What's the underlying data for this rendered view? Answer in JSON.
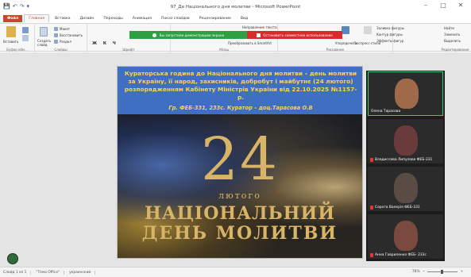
{
  "window": {
    "title": "97_Де Національного дня молитви - Microsoft PowerPoint",
    "controls": [
      "–",
      "□",
      "✕"
    ]
  },
  "quick_access": [
    "💾",
    "↶",
    "↷",
    "▾"
  ],
  "ribbon_tabs": [
    "Файл",
    "Главная",
    "Вставка",
    "Дизайн",
    "Переходы",
    "Анимация",
    "Показ слайдов",
    "Рецензирование",
    "Вид"
  ],
  "ribbon": {
    "paste": "Вставить",
    "create_slide": "Создать слайд",
    "layout": "Макет",
    "restore": "Восстановить",
    "section": "Раздел",
    "group_clipboard": "Буфер обм...",
    "group_slides": "Слайды",
    "group_font": "Шрифт",
    "group_paragraph": "Абзац",
    "group_drawing": "Рисование",
    "group_editing": "Редактирование",
    "text_direction": "Направление текста",
    "convert_smartart": "Преобразовать в SmartArt",
    "arrange": "Упорядочить",
    "quick_styles": "Экспресс-стили",
    "shape_fill": "Заливка фигуры",
    "shape_outline": "Контур фигуры",
    "shape_effects": "Эффекты фигур",
    "find": "Найти",
    "replace": "Заменить",
    "select": "Выделить"
  },
  "share_bar": {
    "sharing_text": "Вы запустили демонстрацию экрана",
    "stop_text": "Остановить совместное использование"
  },
  "slide": {
    "heading": "Кураторська година до Національного дня молитви – день молитви за Україну, її народ, захисників, добробут і майбутнє (24 лютого) розпорядженням Кабінету Міністрів України від 22.10.2025 №1157-р.",
    "subheading": "Гр. ФЕБ-331, 233с. Куратор – доц.Тарасова О.В",
    "date_number": "24",
    "date_month": "лютого",
    "line1": "НАЦІОНАЛЬНИЙ",
    "line2": "ДЕНЬ МОЛИТВИ"
  },
  "participants": [
    {
      "name": "Олена Тарасова",
      "muted": false,
      "face_color": "#a06a4a"
    },
    {
      "name": "Владислава Липулова ФЕБ-331",
      "muted": true,
      "face_color": "#6a3b3b"
    },
    {
      "name": "Серота Валерія ФЕБ-331",
      "muted": true,
      "face_color": "#5a4b45"
    },
    {
      "name": "Анна Гавриленко ФЕБ- 233с",
      "muted": true,
      "face_color": "#7a4a3e"
    }
  ],
  "status": {
    "slide_info": "Слайд 1 из 1",
    "theme": "\"Тема Office\"",
    "language": "украинский",
    "zoom": "78%"
  },
  "colors": {
    "file_tab": "#c9472c",
    "banner_blue": "#3f6fc1",
    "heading_yellow": "#ffd34a",
    "share_green": "#2ea043",
    "share_red": "#d92b2b",
    "gold": "#d8b566"
  }
}
